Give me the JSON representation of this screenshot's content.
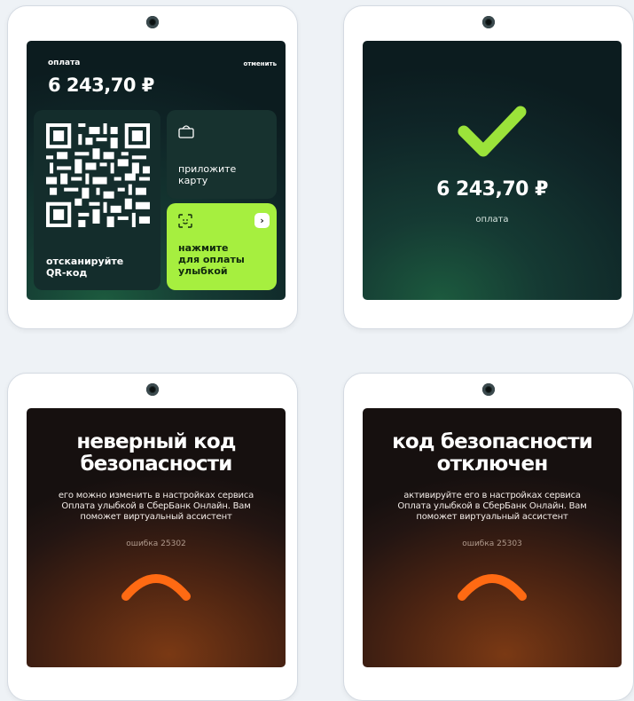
{
  "screens": {
    "qr_payment": {
      "label": "оплата",
      "cancel": "отменить",
      "amount": "6 243,70 ₽",
      "qr_tile_text": [
        "отсканируйте",
        "QR-код"
      ],
      "card_tile_text": [
        "приложите",
        "карту"
      ],
      "smile_tile_text": [
        "нажмите",
        "для оплаты",
        "улыбкой"
      ]
    },
    "success": {
      "amount": "6 243,70 ₽",
      "label": "оплата"
    },
    "wrong_code": {
      "title": [
        "неверный код",
        "безопасности"
      ],
      "description": [
        "его можно изменить в настройках сервиса",
        "Оплата улыбкой в СберБанк Онлайн. Вам",
        "поможет виртуальный ассистент"
      ],
      "error_code": "ошибка 25302"
    },
    "code_disabled": {
      "title": [
        "код безопасности",
        "отключен"
      ],
      "description": [
        "активируйте его в настройках сервиса",
        "Оплата улыбкой в СберБанк Онлайн. Вам",
        "поможет виртуальный ассистент"
      ],
      "error_code": "ошибка 25303"
    }
  },
  "colors": {
    "accent_green": "#a6ef3f",
    "check_green": "#9be33a",
    "frown_orange": "#ff6a13"
  },
  "icons": [
    "camera-icon",
    "qr-code-icon",
    "card-tap-icon",
    "face-scan-icon",
    "chevron-right-icon",
    "checkmark-icon",
    "frown-icon"
  ]
}
